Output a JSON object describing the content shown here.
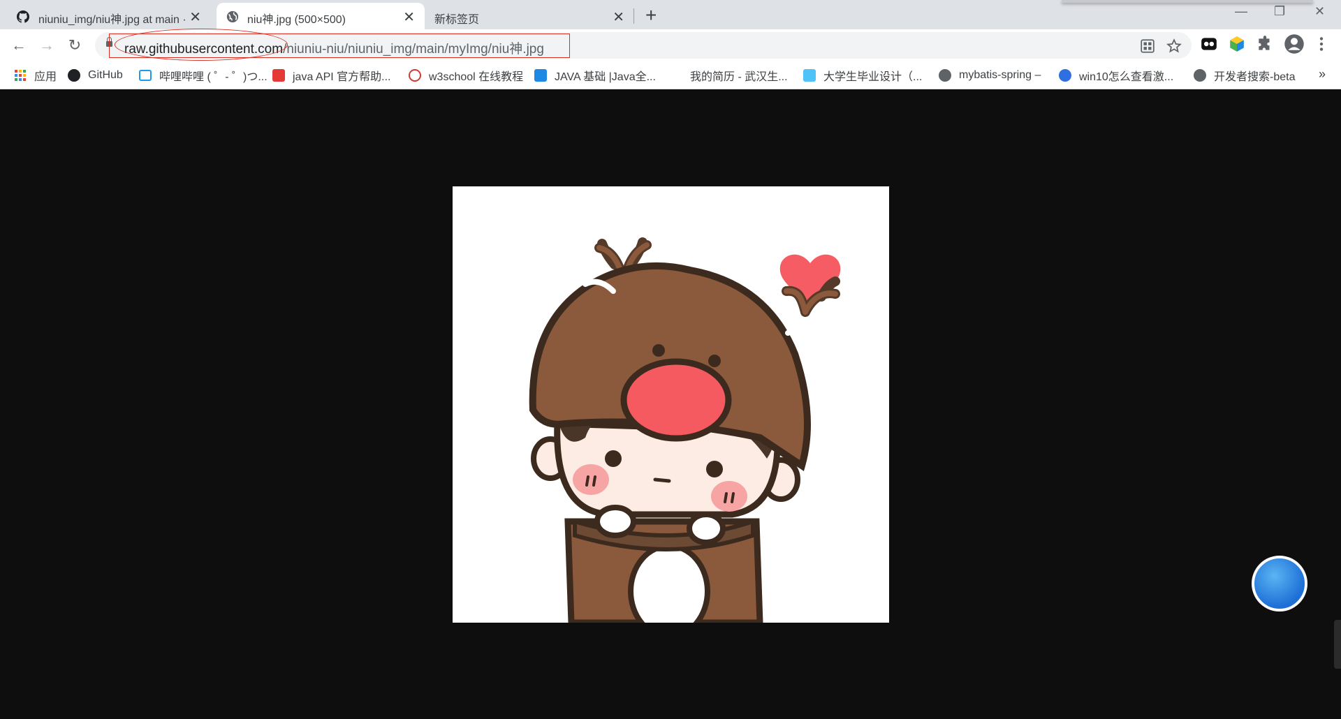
{
  "tabs": [
    {
      "label": "niuniu_img/niu神.jpg at main ·",
      "icon": "github-icon",
      "close": "✕"
    },
    {
      "label": "niu神.jpg (500×500)",
      "icon": "globe-icon",
      "close": "✕"
    },
    {
      "label": "新标签页",
      "icon": "",
      "close": "✕"
    }
  ],
  "newtab_label": "+",
  "window_controls": {
    "minimize": "—",
    "restore": "❐",
    "close": "✕"
  },
  "nav": {
    "back": "←",
    "forward": "→",
    "reload": "↻"
  },
  "address": {
    "host": "raw.githubusercontent.com",
    "path": "/niuniu-niu/niuniu_img/main/myImg/niu神.jpg"
  },
  "bookmarks": [
    {
      "label": "应用",
      "icon": "apps-grid-icon",
      "color": "#ea4335"
    },
    {
      "label": "GitHub",
      "icon": "github-icon",
      "color": "#202124"
    },
    {
      "label": "哔哩哔哩 ( ゜- ゜)つ...",
      "icon": "bilibili-icon",
      "color": "#1e9be8"
    },
    {
      "label": "java API 官方帮助...",
      "icon": "oracle-icon",
      "color": "#e53935"
    },
    {
      "label": "w3school 在线教程",
      "icon": "w3school-icon",
      "color": "#d33833"
    },
    {
      "label": "JAVA 基础 |Java全...",
      "icon": "j-icon",
      "color": "#1e88e5"
    },
    {
      "label": "我的简历 - 武汉生...",
      "icon": "",
      "color": ""
    },
    {
      "label": "大学生毕业设计（...",
      "icon": "mail-icon",
      "color": "#4fc3f7"
    },
    {
      "label": "mybatis-spring –",
      "icon": "globe-icon",
      "color": "#5f6368"
    },
    {
      "label": "win10怎么查看激...",
      "icon": "baidu-paw-icon",
      "color": "#2f6fe0"
    },
    {
      "label": "开发者搜索-beta",
      "icon": "globe-icon",
      "color": "#5f6368"
    }
  ],
  "bookmarks_more": "»",
  "colors": {
    "tabstrip": "#dee1e6",
    "annotation": "#d93025",
    "viewer_bg": "#0e0e0e",
    "antler": "#8b5a3c",
    "nose": "#f45a5f",
    "heart": "#f65c63"
  }
}
